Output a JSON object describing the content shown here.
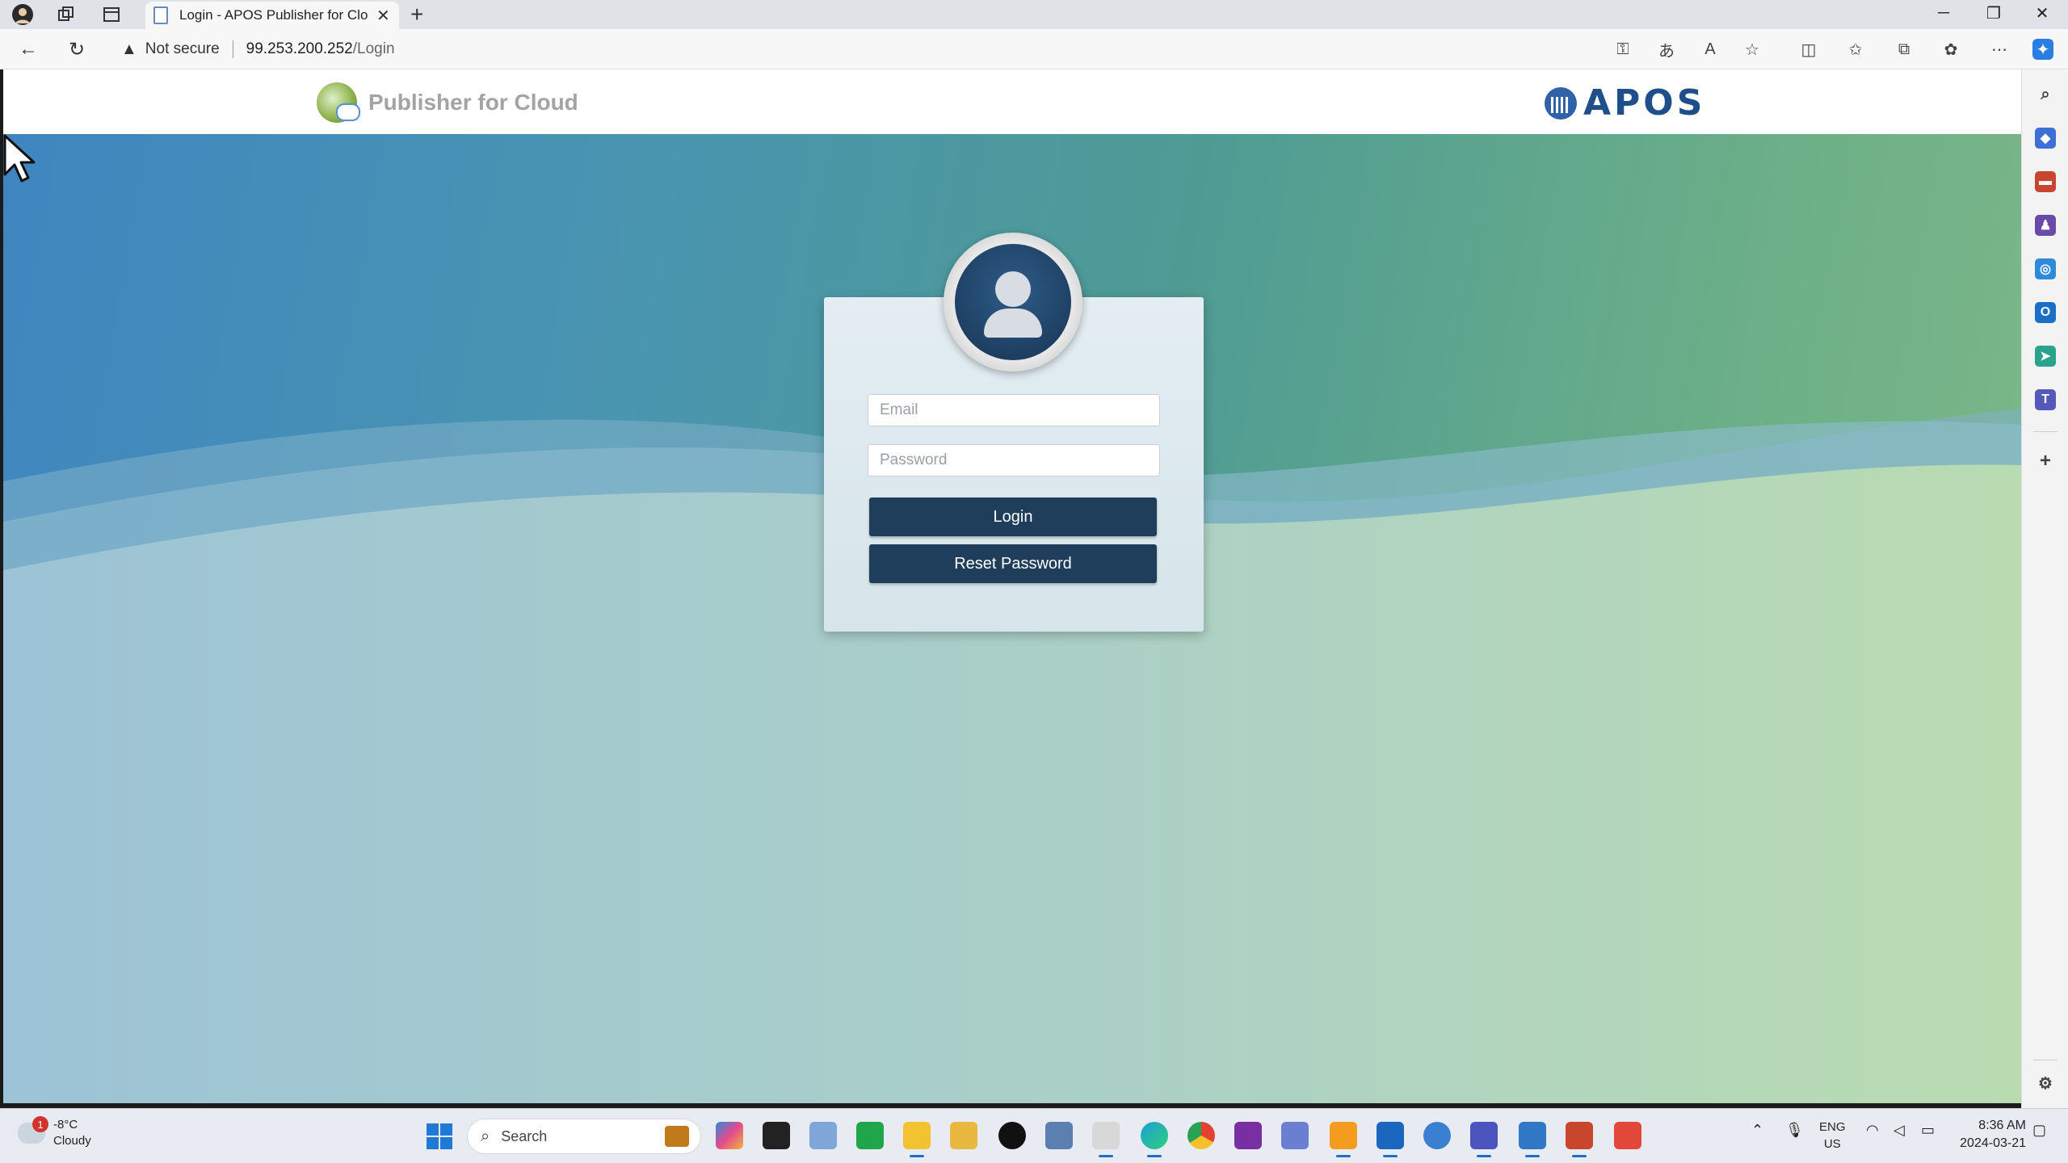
{
  "browser": {
    "tab_title": "Login - APOS Publisher for Cloud",
    "security_label": "Not secure",
    "url_host": "99.253.200.252",
    "url_path": "/Login"
  },
  "header": {
    "product_name": "Publisher for Cloud",
    "company_logo_text": "APOS"
  },
  "login": {
    "email_placeholder": "Email",
    "password_placeholder": "Password",
    "login_label": "Login",
    "reset_label": "Reset Password"
  },
  "taskbar": {
    "weather_temp": "-8°C",
    "weather_desc": "Cloudy",
    "weather_badge": "1",
    "search_placeholder": "Search",
    "lang_top": "ENG",
    "lang_bottom": "US",
    "time": "8:36 AM",
    "date": "2024-03-21"
  },
  "colors": {
    "button_bg": "#1f3e5c",
    "brand_text": "#a3a3a3",
    "apos_blue": "#1f4f8a"
  }
}
